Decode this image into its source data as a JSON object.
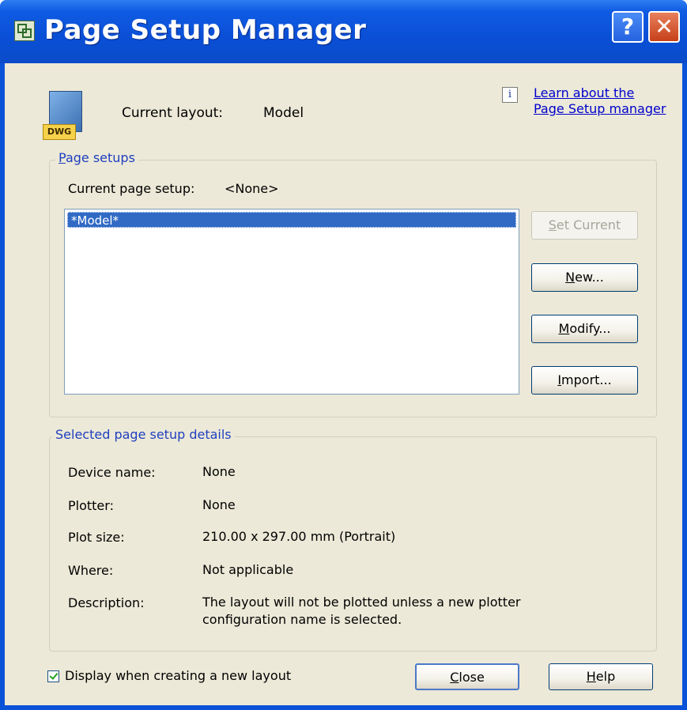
{
  "window": {
    "title": "Page Setup Manager",
    "help_glyph": "?",
    "close_glyph": "✕",
    "app_icon": "page-setup-icon"
  },
  "header": {
    "file_badge": "DWG",
    "current_layout_label": "Current layout:",
    "current_layout_value": "Model",
    "info_glyph": "i",
    "learn_link_line1": "Learn about the",
    "learn_link_line2": "Page Setup manager"
  },
  "page_setups": {
    "group_label_accel": "P",
    "group_label_rest": "age setups",
    "current_setup_label": "Current page setup:",
    "current_setup_value": "<None>",
    "items": [
      "*Model*"
    ],
    "buttons": {
      "set_current": {
        "accel": "S",
        "rest": "et Current",
        "enabled": false
      },
      "new": {
        "accel": "N",
        "rest": "ew..."
      },
      "modify": {
        "accel": "M",
        "rest": "odify..."
      },
      "import": {
        "accel": "I",
        "rest": "mport..."
      }
    }
  },
  "details": {
    "group_label": "Selected page setup details",
    "rows": [
      {
        "label": "Device name:",
        "value": "None"
      },
      {
        "label": "Plotter:",
        "value": "None"
      },
      {
        "label": "Plot size:",
        "value": "210.00 x 297.00 mm (Portrait)"
      },
      {
        "label": "Where:",
        "value": "Not applicable"
      },
      {
        "label": "Description:",
        "value_line1": "The layout will not be plotted unless a new plotter",
        "value_line2": "configuration name is selected."
      }
    ]
  },
  "footer": {
    "checkbox_label": "Display when creating a new layout",
    "checkbox_checked": true,
    "close_button": {
      "accel": "C",
      "rest": "lose"
    },
    "help_button": {
      "accel": "H",
      "rest": "elp"
    }
  },
  "colors": {
    "title_bar": "#0a4fd6",
    "dialog_bg": "#ece9d8",
    "selection": "#316ac5",
    "group_label": "#1f3fbf",
    "link": "#0000cc"
  }
}
